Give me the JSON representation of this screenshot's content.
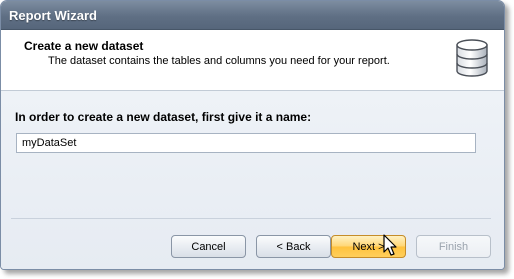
{
  "window": {
    "title": "Report Wizard"
  },
  "header": {
    "title": "Create a new dataset",
    "subtitle": "The dataset contains the tables and columns you need for your report.",
    "icon": "database-icon"
  },
  "form": {
    "prompt": "In order to create a new dataset, first give it a name:",
    "dataset_name_value": "myDataSet"
  },
  "buttons": {
    "cancel": "Cancel",
    "back": "< Back",
    "next": "Next >",
    "finish": "Finish"
  },
  "colors": {
    "titlebar": "#5f6f84",
    "body_background": "#e6ebf2",
    "next_button": "#ffc23d"
  }
}
